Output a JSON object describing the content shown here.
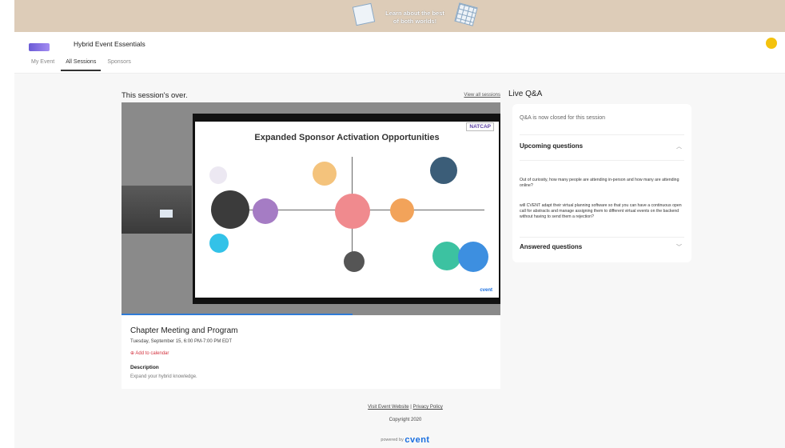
{
  "banner": {
    "text_line1": "Learn about the best",
    "text_line2": "of both worlds!"
  },
  "header": {
    "event_title": "Hybrid Event Essentials",
    "tabs": [
      {
        "label": "My Event"
      },
      {
        "label": "All Sessions"
      },
      {
        "label": "Sponsors"
      }
    ]
  },
  "session": {
    "status": "This session's over.",
    "view_all": "View all sessions",
    "title": "Chapter Meeting and Program",
    "date": "Tuesday, September 15, 6:00 PM-7:00 PM EDT",
    "add_calendar": "⊕ Add to calendar",
    "description_heading": "Description",
    "description": "Expand your hybrid knowledge.",
    "video_progress": 0.61
  },
  "slide": {
    "title": "Expanded Sponsor Activation Opportunities",
    "org": "NATCAP",
    "brand": "cvent"
  },
  "qa": {
    "title": "Live Q&A",
    "closed_text": "Q&A is now closed for this session",
    "upcoming_heading": "Upcoming questions",
    "answered_heading": "Answered questions",
    "questions": [
      "Out of curiosity, how many people are attending in-person and how many are attending online?",
      "will CVENT adapt their virtual planning software so that you can have a continuous open call for abstracts and manage assigning them to different virtual events on the backend without having to send them a rejection?"
    ]
  },
  "footer": {
    "visit_link": "Visit Event Website",
    "separator": "|",
    "privacy_link": "Privacy Policy",
    "copyright": "Copyright 2020",
    "powered_by": "powered by",
    "brand": "cvent"
  },
  "colors": {
    "accent": "#2f7bd6",
    "danger": "#d3333f",
    "avatar": "#f4c20d",
    "banner": "#ddccb8"
  }
}
